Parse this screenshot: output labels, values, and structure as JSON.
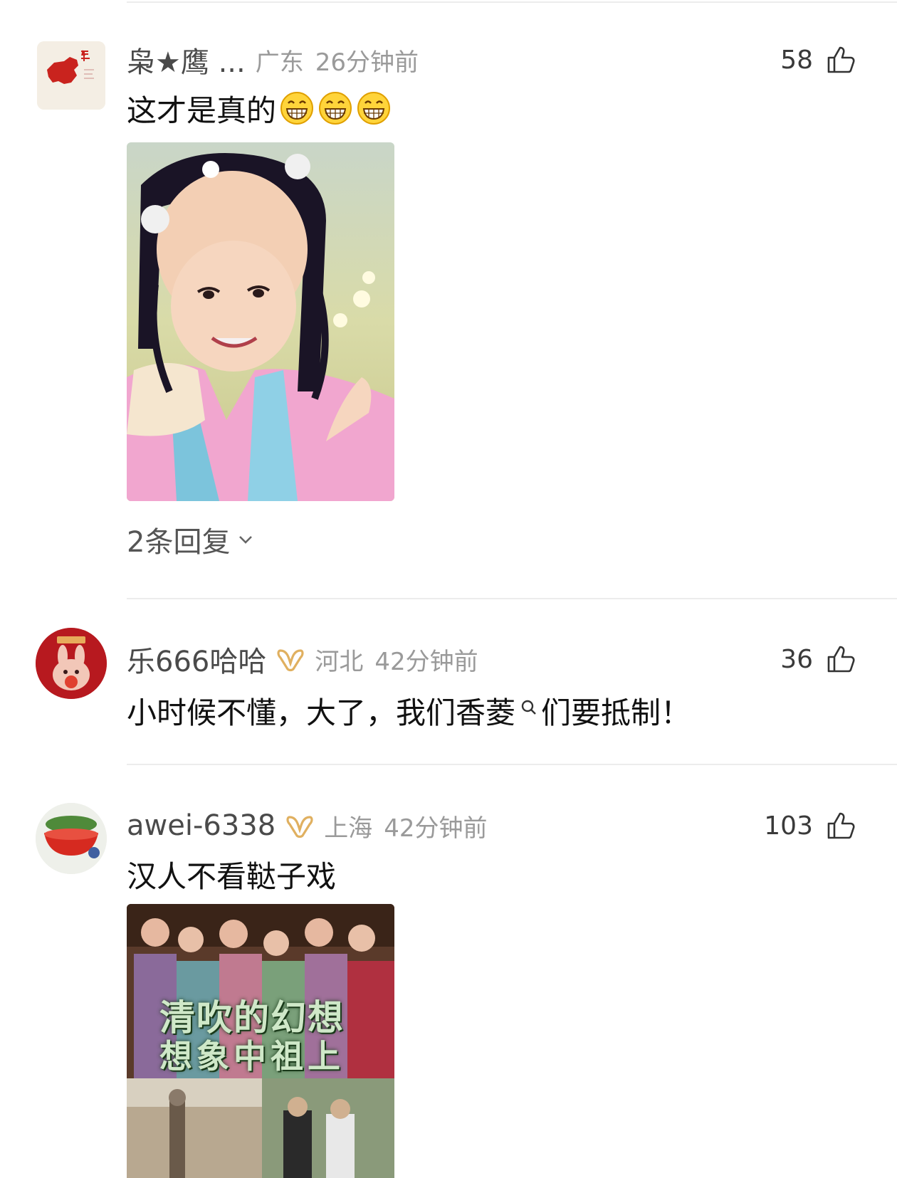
{
  "comments": [
    {
      "user": "枭★鹰 ...",
      "location": "广东",
      "time": "26分钟前",
      "likes": "58",
      "text": "这才是真的",
      "emoji": [
        "grin-emoji",
        "grin-emoji",
        "grin-emoji"
      ],
      "replies": "2条回复"
    },
    {
      "user": "乐666哈哈",
      "location": "河北",
      "time": "42分钟前",
      "likes": "36",
      "text_parts": [
        "小时候不懂，大了，我们",
        "香菱",
        "们要抵制！"
      ]
    },
    {
      "user": "awei-6338",
      "location": "上海",
      "time": "42分钟前",
      "likes": "103",
      "text": "汉人不看鞑子戏",
      "image_caption_line1": "清吹的幻想",
      "image_caption_line2": "想象中祖上"
    }
  ],
  "colors": {
    "meta": "#9a9a9a",
    "name": "#4a4a4a",
    "badge": "#e0b060",
    "divider": "#ececec"
  }
}
